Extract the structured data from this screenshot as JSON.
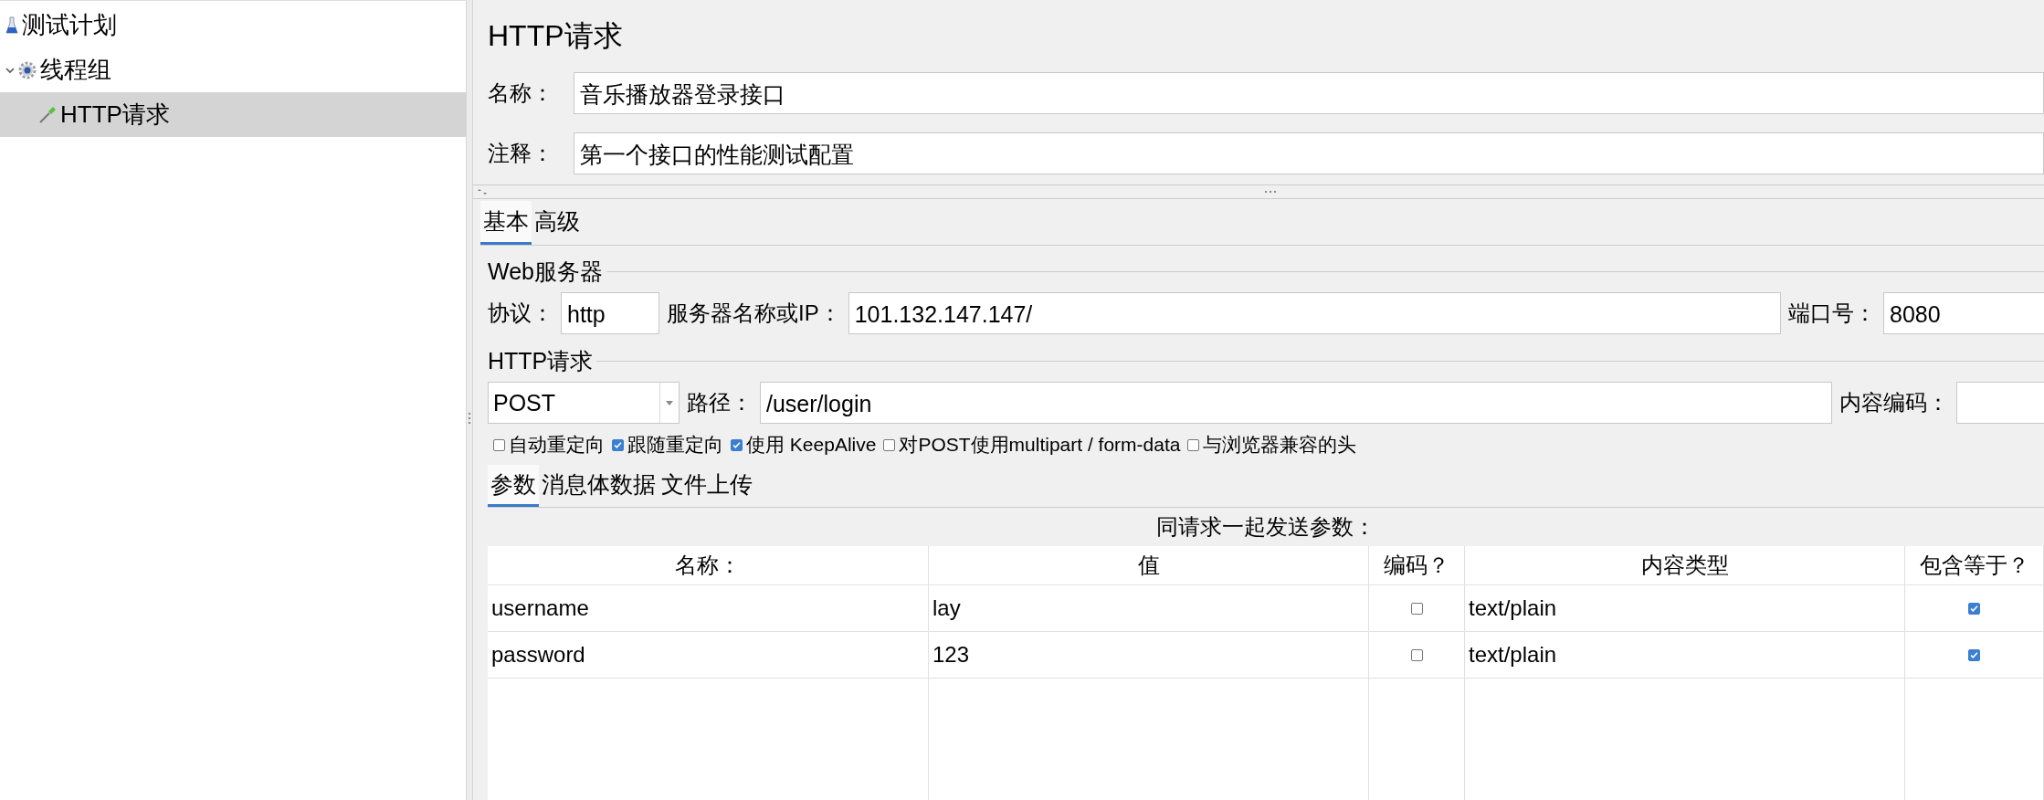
{
  "tree": [
    {
      "label": "测试计划",
      "kind": "plan",
      "selected": false
    },
    {
      "label": "线程组",
      "kind": "group",
      "selected": false,
      "expanded": true,
      "children": [
        {
          "label": "HTTP请求",
          "kind": "sampler",
          "selected": true
        }
      ]
    }
  ],
  "title": "HTTP请求",
  "name_field": {
    "label": "名称：",
    "value": "音乐播放器登录接口"
  },
  "comment_field": {
    "label": "注释：",
    "value": "第一个接口的性能测试配置"
  },
  "tabs": [
    {
      "label": "基本",
      "selected": true
    },
    {
      "label": "高级",
      "selected": false
    }
  ],
  "web_server": {
    "title": "Web服务器",
    "protocol": {
      "label": "协议：",
      "value": "http"
    },
    "server": {
      "label": "服务器名称或IP：",
      "value": "101.132.147.147/"
    },
    "port": {
      "label": "端口号：",
      "value": "8080"
    }
  },
  "http_request": {
    "title": "HTTP请求",
    "method": "POST",
    "path": {
      "label": "路径：",
      "value": "/user/login"
    },
    "encoding": {
      "label": "内容编码："
    },
    "options": [
      {
        "label": "自动重定向",
        "checked": false
      },
      {
        "label": "跟随重定向",
        "checked": true
      },
      {
        "label": "使用 KeepAlive",
        "checked": true
      },
      {
        "label": "对POST使用multipart / form-data",
        "checked": false
      },
      {
        "label": "与浏览器兼容的头",
        "checked": false
      }
    ]
  },
  "param_tabs": [
    {
      "label": "参数",
      "selected": true
    },
    {
      "label": "消息体数据",
      "selected": false
    },
    {
      "label": "文件上传",
      "selected": false
    }
  ],
  "parameters": {
    "caption": "同请求一起发送参数：",
    "columns": [
      "名称：",
      "值",
      "编码？",
      "内容类型",
      "包含等于？"
    ],
    "rows": [
      {
        "name": "username",
        "value": "lay",
        "encode": false,
        "content_type": "text/plain",
        "include_equals": true
      },
      {
        "name": "password",
        "value": "123",
        "encode": false,
        "content_type": "text/plain",
        "include_equals": true
      }
    ]
  }
}
